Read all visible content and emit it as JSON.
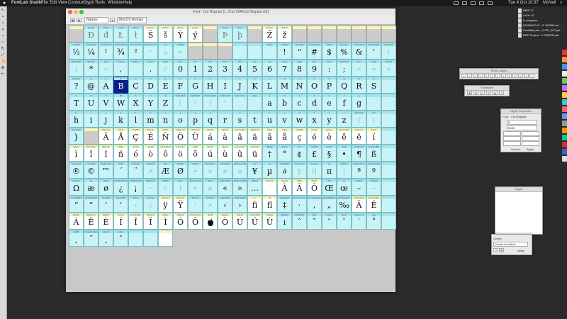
{
  "menubar": {
    "app_name": "FontLab Studio",
    "items": [
      "File",
      "Edit",
      "View",
      "Contour",
      "Glyph",
      "Tools",
      "Window",
      "Help"
    ],
    "clock": "Tue 4 Oct 10:37",
    "user": "McNeil"
  },
  "font_window": {
    "title": "Font - Cut Regular [/.../Cut VFA/Cut Regular.vfb]",
    "name_mode": "Names",
    "encoding": "MacOS Roman"
  },
  "glyph_rows": [
    {
      "labels": [
        "",
        "Dcroat",
        "dcroat",
        "Lslash",
        "lslash",
        "Scaron",
        "scaron",
        "Yacute",
        "yacute",
        "",
        "Thorn",
        "thorn",
        "",
        "Zcaron",
        "zcaron",
        "",
        "",
        "",
        "",
        "",
        "",
        ""
      ],
      "glyphs": [
        "",
        "Đ",
        "đ",
        "Ł",
        "ł",
        "Š",
        "š",
        "Ý",
        "ý",
        "",
        "Þ",
        "þ",
        "",
        "Ž",
        "ž",
        "",
        "",
        "",
        "",
        "",
        "",
        ""
      ],
      "kinds": [
        "g",
        "e",
        "e",
        "e",
        "e",
        "w",
        "w",
        "w",
        "w",
        "g",
        "e",
        "e",
        "g",
        "w",
        "w",
        "g",
        "g",
        "g",
        "g",
        "g",
        "g",
        "g"
      ]
    },
    {
      "labels": [
        "onehalf",
        "onequarter",
        "onesuperior",
        "threequarters",
        "twosuperior",
        "threesuperior",
        "mu",
        "multiply",
        "",
        "",
        "",
        "",
        "",
        "space",
        "exclam",
        "quotedbl",
        "numbersign",
        "dollar",
        "percent",
        "ampersand",
        "quotesingle",
        "parenleft"
      ],
      "glyphs": [
        "½",
        "¼",
        "¹",
        "¾",
        "²",
        "³",
        "µ",
        "×",
        "",
        "",
        "",
        "",
        "",
        "",
        "!",
        "\"",
        "#",
        "$",
        "%",
        "&",
        "'",
        "("
      ],
      "kinds": [
        "c",
        "c",
        "c",
        "c",
        "c",
        "f",
        "f",
        "f",
        "g",
        "g",
        "g",
        "c",
        "c",
        "c",
        "c",
        "c",
        "c",
        "c",
        "c",
        "c",
        "c",
        "f"
      ]
    },
    {
      "labels": [
        "parenright",
        "asterisk",
        "plus",
        "comma",
        "hyphen",
        "period",
        "slash",
        "zero",
        "one",
        "two",
        "three",
        "four",
        "five",
        "six",
        "seven",
        "eight",
        "nine",
        "colon",
        "semicolon",
        "less",
        "equal",
        "greater"
      ],
      "glyphs": [
        ")",
        "*",
        "+",
        ",",
        "-",
        ".",
        "/",
        "0",
        "1",
        "2",
        "3",
        "4",
        "5",
        "6",
        "7",
        "8",
        "9",
        ":",
        ";",
        "<",
        "=",
        ">"
      ],
      "kinds": [
        "f",
        "c",
        "f",
        "c",
        "f",
        "c",
        "f",
        "c",
        "c",
        "c",
        "c",
        "c",
        "c",
        "c",
        "c",
        "c",
        "c",
        "c",
        "c",
        "f",
        "f",
        "f"
      ]
    },
    {
      "labels": [
        "question",
        "at",
        "A",
        "B",
        "C",
        "D",
        "E",
        "F",
        "G",
        "H",
        "I",
        "J",
        "K",
        "L",
        "M",
        "N",
        "O",
        "P",
        "Q",
        "R",
        "S",
        ""
      ],
      "glyphs": [
        "?",
        "@",
        "A",
        "B",
        "C",
        "D",
        "E",
        "F",
        "G",
        "H",
        "I",
        "J",
        "K",
        "L",
        "M",
        "N",
        "O",
        "P",
        "Q",
        "R",
        "S",
        ""
      ],
      "kinds": [
        "c",
        "c",
        "c",
        "s",
        "c",
        "c",
        "c",
        "c",
        "c",
        "c",
        "c",
        "c",
        "c",
        "c",
        "c",
        "c",
        "c",
        "c",
        "c",
        "c",
        "c",
        "c"
      ]
    },
    {
      "labels": [
        "T",
        "U",
        "V",
        "W",
        "X",
        "Y",
        "Z",
        "bracketleft",
        "backslash",
        "bracketright",
        "asciicircum",
        "underscore",
        "grave",
        "a",
        "b",
        "c",
        "d",
        "e",
        "f",
        "g",
        "",
        ""
      ],
      "glyphs": [
        "T",
        "U",
        "V",
        "W",
        "X",
        "Y",
        "Z",
        "[",
        "\\",
        "]",
        "^",
        "_",
        "`",
        "a",
        "b",
        "c",
        "d",
        "e",
        "f",
        "g",
        "",
        ""
      ],
      "kinds": [
        "c",
        "c",
        "c",
        "c",
        "c",
        "c",
        "c",
        "f",
        "f",
        "f",
        "f",
        "f",
        "f",
        "c",
        "c",
        "c",
        "c",
        "c",
        "c",
        "c",
        "c",
        "c"
      ]
    },
    {
      "labels": [
        "h",
        "i",
        "j",
        "k",
        "l",
        "m",
        "n",
        "o",
        "p",
        "q",
        "r",
        "s",
        "t",
        "u",
        "v",
        "w",
        "x",
        "y",
        "z",
        "braceleft",
        "bar",
        ""
      ],
      "glyphs": [
        "h",
        "i",
        "j",
        "k",
        "l",
        "m",
        "n",
        "o",
        "p",
        "q",
        "r",
        "s",
        "t",
        "u",
        "v",
        "w",
        "x",
        "y",
        "z",
        "{",
        "|",
        ""
      ],
      "kinds": [
        "c",
        "c",
        "c",
        "c",
        "c",
        "c",
        "c",
        "c",
        "c",
        "c",
        "c",
        "c",
        "c",
        "c",
        "c",
        "c",
        "c",
        "c",
        "c",
        "f",
        "f",
        "c"
      ]
    },
    {
      "labels": [
        "braceright",
        "",
        "Adieresis",
        "Aring",
        "Ccedilla",
        "Eacute",
        "Ntilde",
        "Odieresis",
        "Udieresis",
        "aacute",
        "agrave",
        "acircumflex",
        "adieresis",
        "atilde",
        "aring",
        "ccedilla",
        "eacute",
        "egrave",
        "ecircumflex",
        "edieresis",
        "iacute",
        ""
      ],
      "glyphs": [
        "}",
        "",
        "Ä",
        "Å",
        "Ç",
        "É",
        "Ñ",
        "Ö",
        "Ü",
        "á",
        "à",
        "â",
        "ä",
        "ã",
        "å",
        "ç",
        "é",
        "è",
        "ê",
        "ë",
        "í",
        ""
      ],
      "kinds": [
        "c",
        "g",
        "w",
        "w",
        "w",
        "w",
        "w",
        "w",
        "w",
        "w",
        "w",
        "w",
        "w",
        "w",
        "w",
        "w",
        "w",
        "w",
        "w",
        "w",
        "w",
        "c"
      ]
    },
    {
      "labels": [
        "igrave",
        "icircumflex",
        "idieresis",
        "ntilde",
        "oacute",
        "ograve",
        "ocircumflex",
        "odieresis",
        "otilde",
        "uacute",
        "ugrave",
        "ucircumflex",
        "udieresis",
        "dagger",
        "degree",
        "cent",
        "sterling",
        "section",
        "bullet",
        "paragraph",
        "germandbls",
        ""
      ],
      "glyphs": [
        "ì",
        "î",
        "ï",
        "ñ",
        "ó",
        "ò",
        "ô",
        "ö",
        "õ",
        "ú",
        "ù",
        "û",
        "ü",
        "†",
        "°",
        "¢",
        "£",
        "§",
        "•",
        "¶",
        "ß",
        ""
      ],
      "kinds": [
        "w",
        "w",
        "w",
        "w",
        "w",
        "w",
        "w",
        "w",
        "w",
        "w",
        "w",
        "w",
        "w",
        "c",
        "c",
        "c",
        "c",
        "c",
        "c",
        "c",
        "c",
        "c"
      ]
    },
    {
      "labels": [
        "registered",
        "copyright",
        "trademark",
        "acute",
        "dieresis",
        "notequal",
        "AE",
        "Oslash",
        "infinity",
        "plusminus",
        "lessequal",
        "greaterequal",
        "yen",
        "mu",
        "partialdiff",
        "summation",
        "product",
        "pi",
        "integral",
        "ordfeminine",
        "ordmasculine",
        ""
      ],
      "glyphs": [
        "®",
        "©",
        "™",
        "´",
        "¨",
        "≠",
        "Æ",
        "Ø",
        "∞",
        "±",
        "≤",
        "≥",
        "¥",
        "µ",
        "∂",
        "∑",
        "∏",
        "π",
        "∫",
        "ª",
        "º",
        ""
      ],
      "kinds": [
        "c",
        "c",
        "c",
        "c",
        "c",
        "f",
        "c",
        "c",
        "f",
        "f",
        "f",
        "f",
        "c",
        "c",
        "c",
        "f",
        "f",
        "c",
        "f",
        "c",
        "c",
        "c"
      ]
    },
    {
      "labels": [
        "Omega",
        "ae",
        "oslash",
        "questiondown",
        "exclamdown",
        "logicalnot",
        "radical",
        "florin",
        "approxequal",
        "Delta",
        "guillemotleft",
        "guillemotright",
        "ellipsis",
        "nbspace",
        "Agrave",
        "Atilde",
        "Otilde",
        "OE",
        "oe",
        "endash",
        "emdash",
        ""
      ],
      "glyphs": [
        "Ω",
        "æ",
        "ø",
        "¿",
        "¡",
        "¬",
        "√",
        "ƒ",
        "≈",
        "∆",
        "«",
        "»",
        "…",
        "",
        "À",
        "Ã",
        "Õ",
        "Œ",
        "œ",
        "–",
        "—",
        ""
      ],
      "kinds": [
        "c",
        "c",
        "c",
        "c",
        "c",
        "f",
        "f",
        "f",
        "f",
        "f",
        "c",
        "c",
        "c",
        "w",
        "w",
        "w",
        "w",
        "c",
        "c",
        "c",
        "f",
        "c"
      ]
    },
    {
      "labels": [
        "quotedblleft",
        "quotedblright",
        "quoteleft",
        "quoteright",
        "divide",
        "lozenge",
        "ydieresis",
        "Ydieresis",
        "fraction",
        "currency",
        "guilsinglleft",
        "guilsinglright",
        "fi",
        "fl",
        "daggerdbl",
        "periodcentered",
        "quotesinglbase",
        "quotedblbase",
        "perthousand",
        "Acircumflex",
        "Ecircumflex",
        ""
      ],
      "glyphs": [
        "“",
        "”",
        "‘",
        "’",
        "÷",
        "◊",
        "ÿ",
        "Ÿ",
        "⁄",
        "¤",
        "‹",
        "›",
        "ﬁ",
        "ﬂ",
        "‡",
        "·",
        "‚",
        "„",
        "‰",
        "Â",
        "Ê",
        ""
      ],
      "kinds": [
        "c",
        "c",
        "c",
        "c",
        "f",
        "f",
        "w",
        "w",
        "f",
        "f",
        "c",
        "c",
        "w",
        "w",
        "c",
        "c",
        "c",
        "c",
        "c",
        "w",
        "w",
        "c"
      ]
    },
    {
      "labels": [
        "Aacute",
        "Edieresis",
        "Egrave",
        "Iacute",
        "Icircumflex",
        "Idieresis",
        "Igrave",
        "Oacute",
        "Ocircumflex",
        "apple",
        "Ograve",
        "Uacute",
        "Ucircumflex",
        "Ugrave",
        "dotlessi",
        "circumflex",
        "tilde",
        "macron",
        "breve",
        "dotaccent",
        "ring",
        ""
      ],
      "glyphs": [
        "Á",
        "Ë",
        "È",
        "Í",
        "Î",
        "Ï",
        "Ì",
        "Ó",
        "Ô",
        "",
        "Ò",
        "Ú",
        "Û",
        "Ù",
        "ı",
        "ˆ",
        "˜",
        "¯",
        "˘",
        "˙",
        "˚",
        ""
      ],
      "kinds": [
        "w",
        "w",
        "w",
        "w",
        "w",
        "w",
        "w",
        "w",
        "w",
        "a",
        "w",
        "w",
        "w",
        "w",
        "c",
        "c",
        "c",
        "c",
        "c",
        "c",
        "c",
        "c"
      ]
    },
    {
      "labels": [
        "cedilla",
        "hungarumlaut",
        "ogonek",
        "caron",
        "",
        "",
        "",
        "",
        "",
        "",
        "",
        "",
        "",
        "",
        "",
        "",
        "",
        "",
        "",
        "",
        "",
        ""
      ],
      "glyphs": [
        "¸",
        "˝",
        "˛",
        "ˇ",
        "",
        "",
        "",
        "",
        "",
        "",
        "",
        "",
        "",
        "",
        "",
        "",
        "",
        "",
        "",
        "",
        "",
        ""
      ],
      "kinds": [
        "c",
        "c",
        "c",
        "c",
        "c",
        "c",
        "w",
        "x",
        "x",
        "x",
        "x",
        "x",
        "x",
        "x",
        "x",
        "x",
        "x",
        "x",
        "x",
        "x",
        "x",
        "x"
      ]
    }
  ],
  "palettes": {
    "show_layers": {
      "title": "Show Layers"
    },
    "transform": {
      "title": "Transform"
    },
    "glyph_properties": {
      "title": "Glyph Properties",
      "font_label": "Font:",
      "font_value": "Cut-Regular",
      "name_value": "B",
      "unicode_value": "0042",
      "cancel": "Cancel",
      "apply": "Apply"
    },
    "glyph_window": {
      "title": "Glyph"
    },
    "center_panel": {
      "label": "Center",
      "option": "Center of selecti",
      "apply": "Apply"
    }
  },
  "desktop_items": [
    {
      "label": "NEW 17"
    },
    {
      "label": "LeCin 07"
    },
    {
      "label": "In progress"
    },
    {
      "label": "6AG86IYD-N...G 160000.wd"
    },
    {
      "label": "KantaBey.sic...(Y-PR_907.pdf"
    },
    {
      "label": "DRP Project...V ORDER.pdf"
    }
  ],
  "colors": {
    "glyph_cell": "#c8f4f7",
    "glyph_label": "#a9e4ec",
    "selected_cell": "#0a1f8a",
    "accented_label": "#fbf6b6",
    "desktop": "#2b2b2b"
  }
}
